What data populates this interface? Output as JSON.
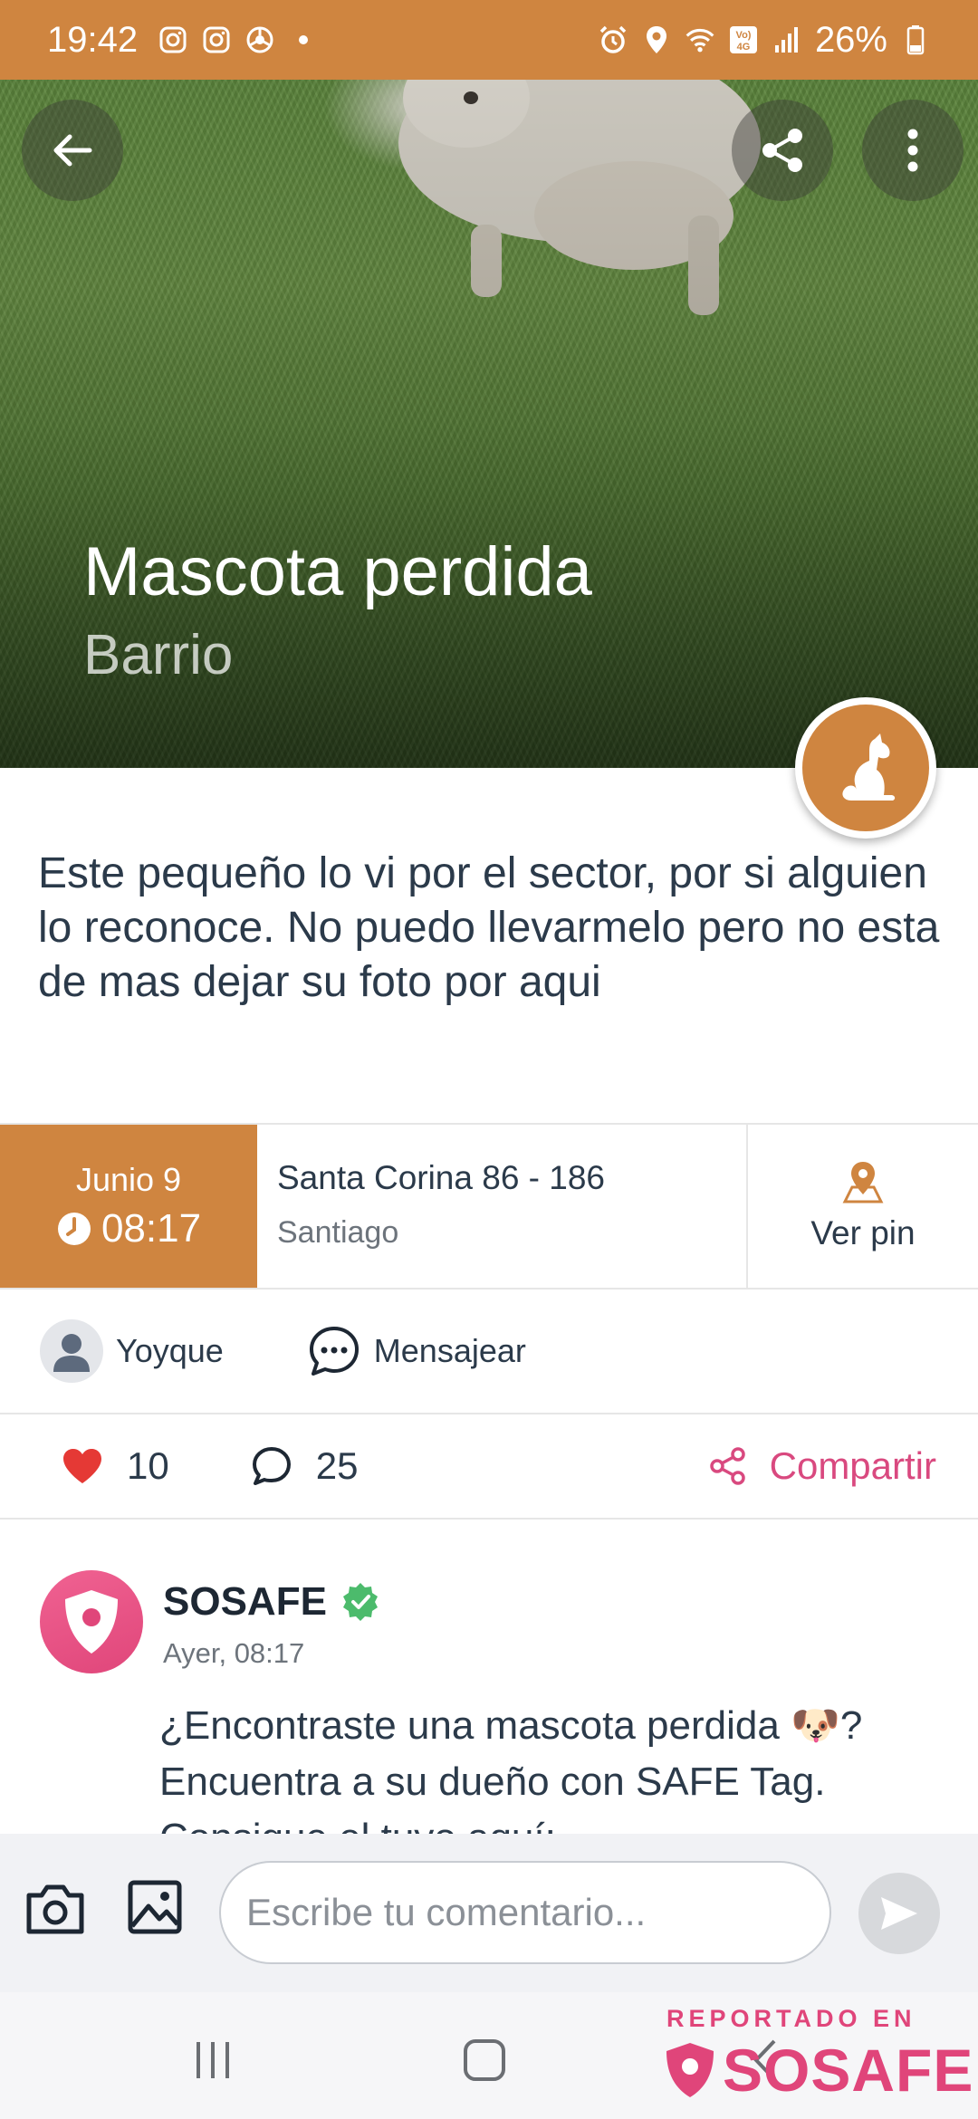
{
  "status_bar": {
    "time": "19:42",
    "battery": "26%",
    "network_badge": "Vo) 4G"
  },
  "hero": {
    "title": "Mascota perdida",
    "subtitle": "Barrio"
  },
  "post": {
    "description": "Este pequeño lo vi por el sector, por si alguien lo reconoce. No puedo llevarmelo pero no esta de mas dejar su foto por aqui"
  },
  "info": {
    "date": "Junio 9",
    "time": "08:17",
    "street": "Santa Corina  86 - 186",
    "city": "Santiago",
    "pin_label": "Ver pin"
  },
  "author": {
    "name": "Yoyque",
    "message_label": "Mensajear"
  },
  "stats": {
    "likes": "10",
    "comments": "25",
    "share_label": "Compartir"
  },
  "comment": {
    "author": "SOSAFE",
    "time": "Ayer, 08:17",
    "body": "¿Encontraste una mascota perdida 🐶? Encuentra a su dueño con SAFE Tag. Consigue el tuyo aquí:"
  },
  "composer": {
    "placeholder": "Escribe tu comentario..."
  },
  "watermark": {
    "line1": "REPORTADO EN",
    "brand": "SOSAFE"
  },
  "colors": {
    "accent": "#cf8540",
    "brand_pink": "#e0457a",
    "like_red": "#e53935",
    "verified_green": "#4cbb6c"
  }
}
